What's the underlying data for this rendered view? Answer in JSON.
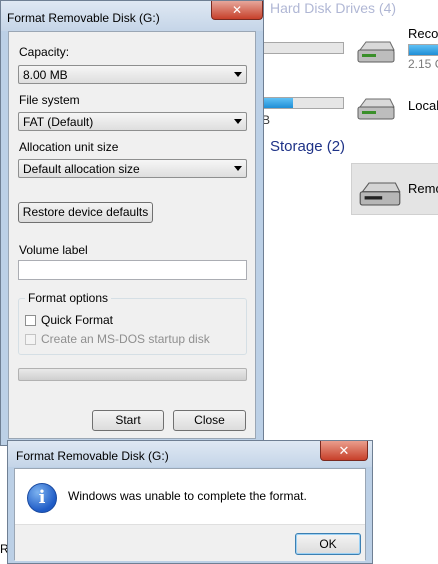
{
  "background": {
    "cut_title": "Hard Disk Drives (4)",
    "section_heading": "Storage (2)",
    "drives": [
      {
        "label": "Recov",
        "sub": "2.15 G"
      },
      {
        "label": "Local",
        "sub": ""
      },
      {
        "label": "Remo",
        "sub": ""
      }
    ],
    "partial_b": "B",
    "bottom_left_char": "R"
  },
  "format_dialog": {
    "title": "Format Removable Disk (G:)",
    "close_glyph": "✕",
    "capacity_label": "Capacity:",
    "capacity_value": "8.00 MB",
    "filesystem_label": "File system",
    "filesystem_value": "FAT (Default)",
    "allocation_label": "Allocation unit size",
    "allocation_value": "Default allocation size",
    "restore_button": "Restore device defaults",
    "volume_label": "Volume label",
    "volume_value": "",
    "format_options_label": "Format options",
    "quick_format_label": "Quick Format",
    "msdos_label": "Create an MS-DOS startup disk",
    "progress": 0,
    "start_button": "Start",
    "close_button": "Close"
  },
  "message_box": {
    "title": "Format Removable Disk (G:)",
    "close_glyph": "✕",
    "message": "Windows was unable to complete the format.",
    "ok_button": "OK"
  },
  "icons": [
    "info-icon",
    "drive-icon",
    "close-icon",
    "chevron-down-icon"
  ],
  "colors": {
    "accent_title": "#1e3287",
    "progress_fill": "#1f8fd6",
    "close_button": "#c7402a"
  }
}
